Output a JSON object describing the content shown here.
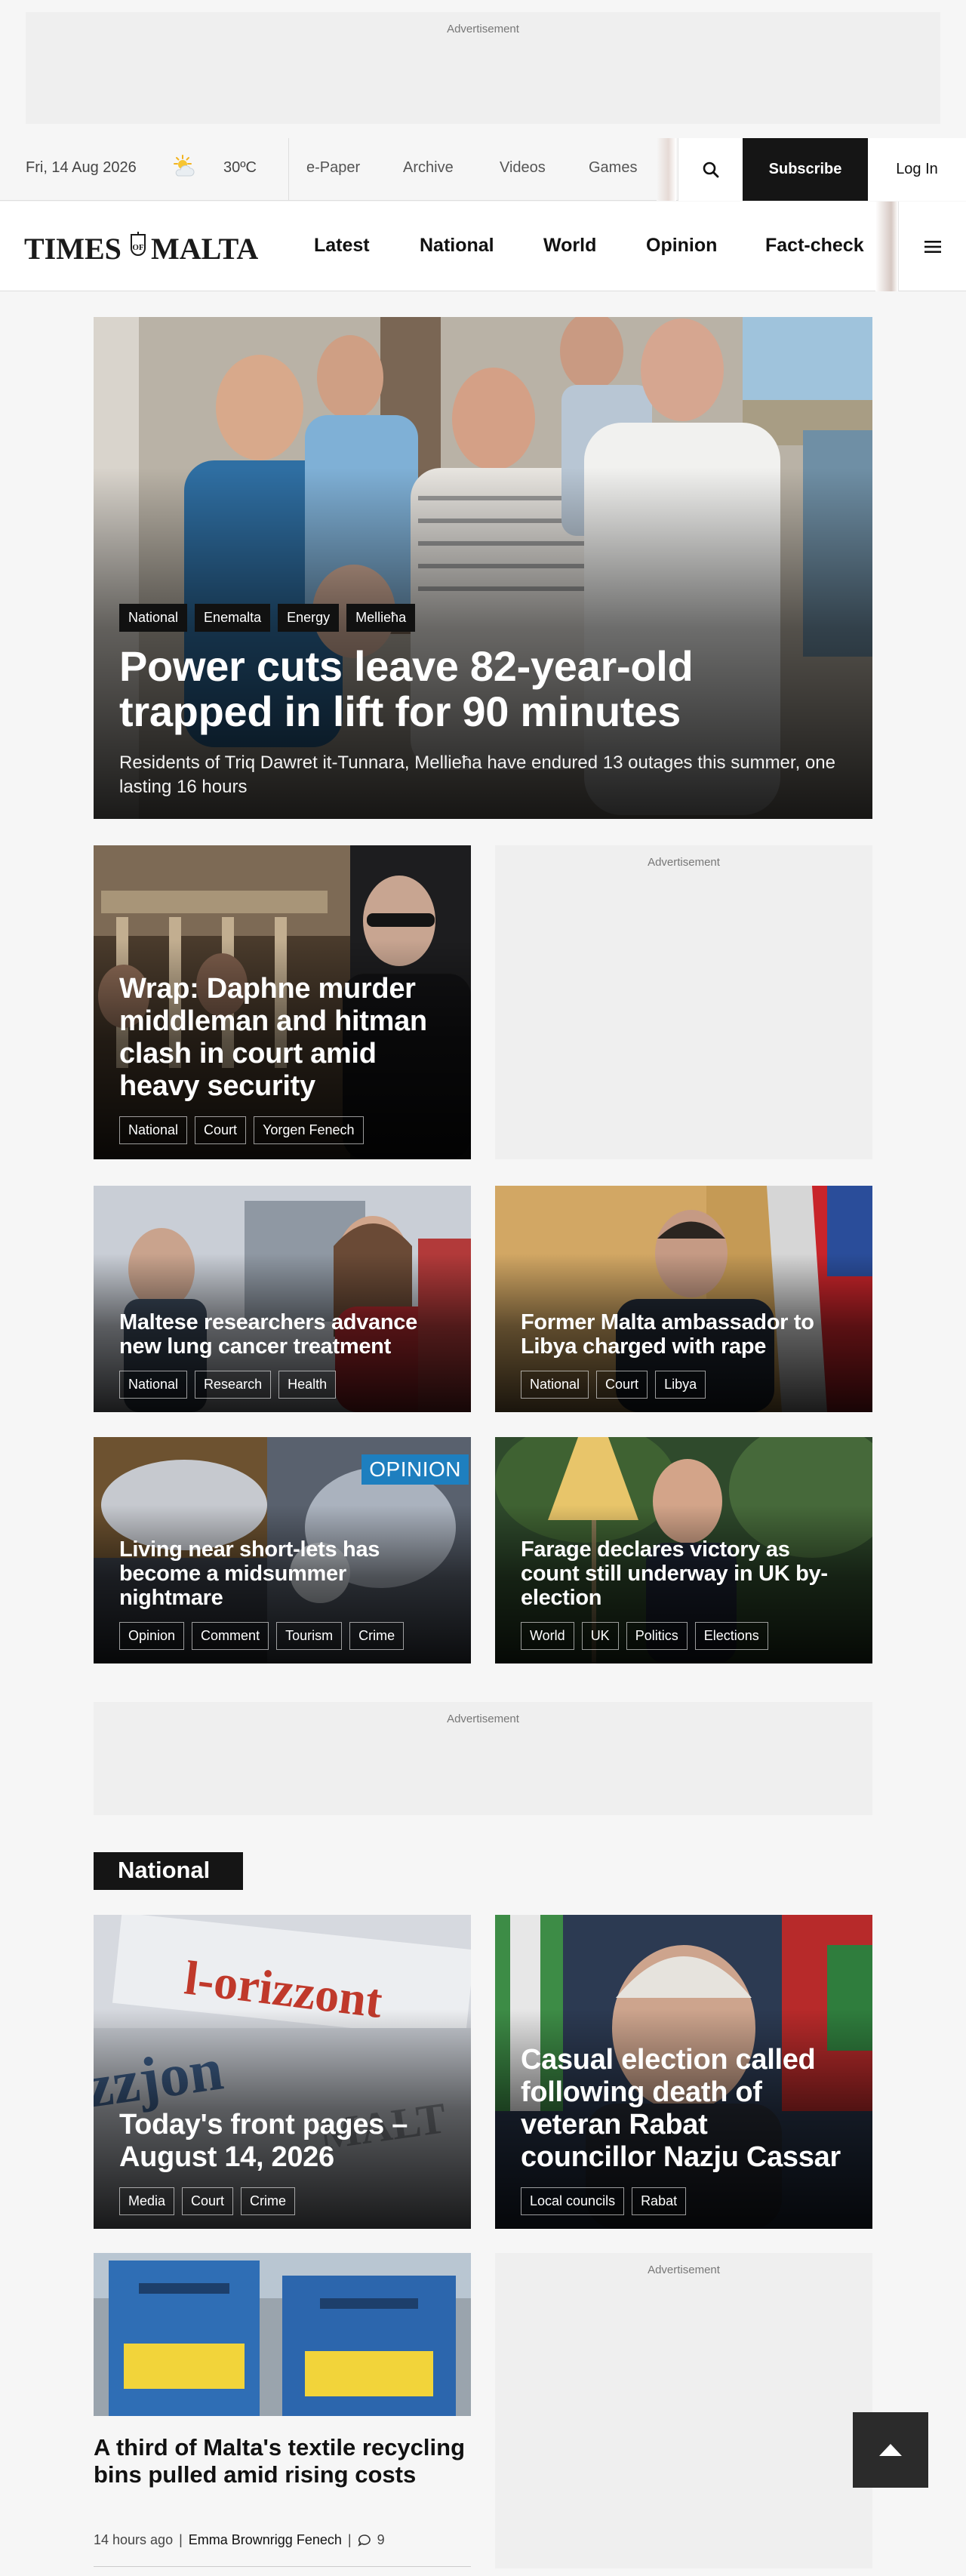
{
  "ads": {
    "top": "Advertisement",
    "side1": "Advertisement",
    "mid": "Advertisement",
    "side2": "Advertisement"
  },
  "utility": {
    "date": "Fri, 14 Aug 2026",
    "weather_icon": "sun-cloud-icon",
    "temperature": "30ºC",
    "links": [
      "e-Paper",
      "Archive",
      "Videos",
      "Games"
    ],
    "subscribe": "Subscribe",
    "login": "Log In"
  },
  "nav": {
    "logo_left": "TIMES",
    "logo_of": "OF",
    "logo_right": "MALTA",
    "links": [
      "Latest",
      "National",
      "World",
      "Opinion",
      "Fact-check"
    ]
  },
  "hero": {
    "tags": [
      "National",
      "Enemalta",
      "Energy",
      "Mellieħa"
    ],
    "headline": "Power cuts leave 82-year-old trapped in lift for 90 minutes",
    "summary": "Residents of Triq Dawret it-Tunnara, Mellieħa have endured 13 outages this summer, one lasting 16 hours"
  },
  "stories": [
    {
      "headline": "Wrap: Daphne murder middleman and hitman clash in court amid heavy security",
      "tags": [
        "National",
        "Court",
        "Yorgen Fenech"
      ]
    },
    {
      "headline": "Maltese researchers advance new lung cancer treatment",
      "tags": [
        "National",
        "Research",
        "Health"
      ]
    },
    {
      "headline": "Former Malta ambassador to Libya charged with rape",
      "tags": [
        "National",
        "Court",
        "Libya"
      ]
    },
    {
      "headline": "Living near short-lets has become a midsummer nightmare",
      "badge": "OPINION",
      "tags": [
        "Opinion",
        "Comment",
        "Tourism",
        "Crime"
      ]
    },
    {
      "headline": "Farage declares victory as count still underway in UK by-election",
      "tags": [
        "World",
        "UK",
        "Politics",
        "Elections"
      ]
    }
  ],
  "national_section": {
    "label": "National",
    "stories": [
      {
        "headline": "Today's front pages – August 14, 2026",
        "tags": [
          "Media",
          "Court",
          "Crime"
        ]
      },
      {
        "headline": "Casual election called following death of veteran Rabat councillor Nazju Cassar",
        "tags": [
          "Local councils",
          "Rabat"
        ]
      },
      {
        "headline": "A third of Malta's textile recycling bins pulled amid rising costs",
        "time": "14 hours ago",
        "author": "Emma Brownrigg Fenech",
        "comments": "9"
      }
    ]
  },
  "colors": {
    "subscribe_bg": "#151515",
    "opinion_badge": "#1e7fbf",
    "page_bg": "#f6f6f6"
  }
}
